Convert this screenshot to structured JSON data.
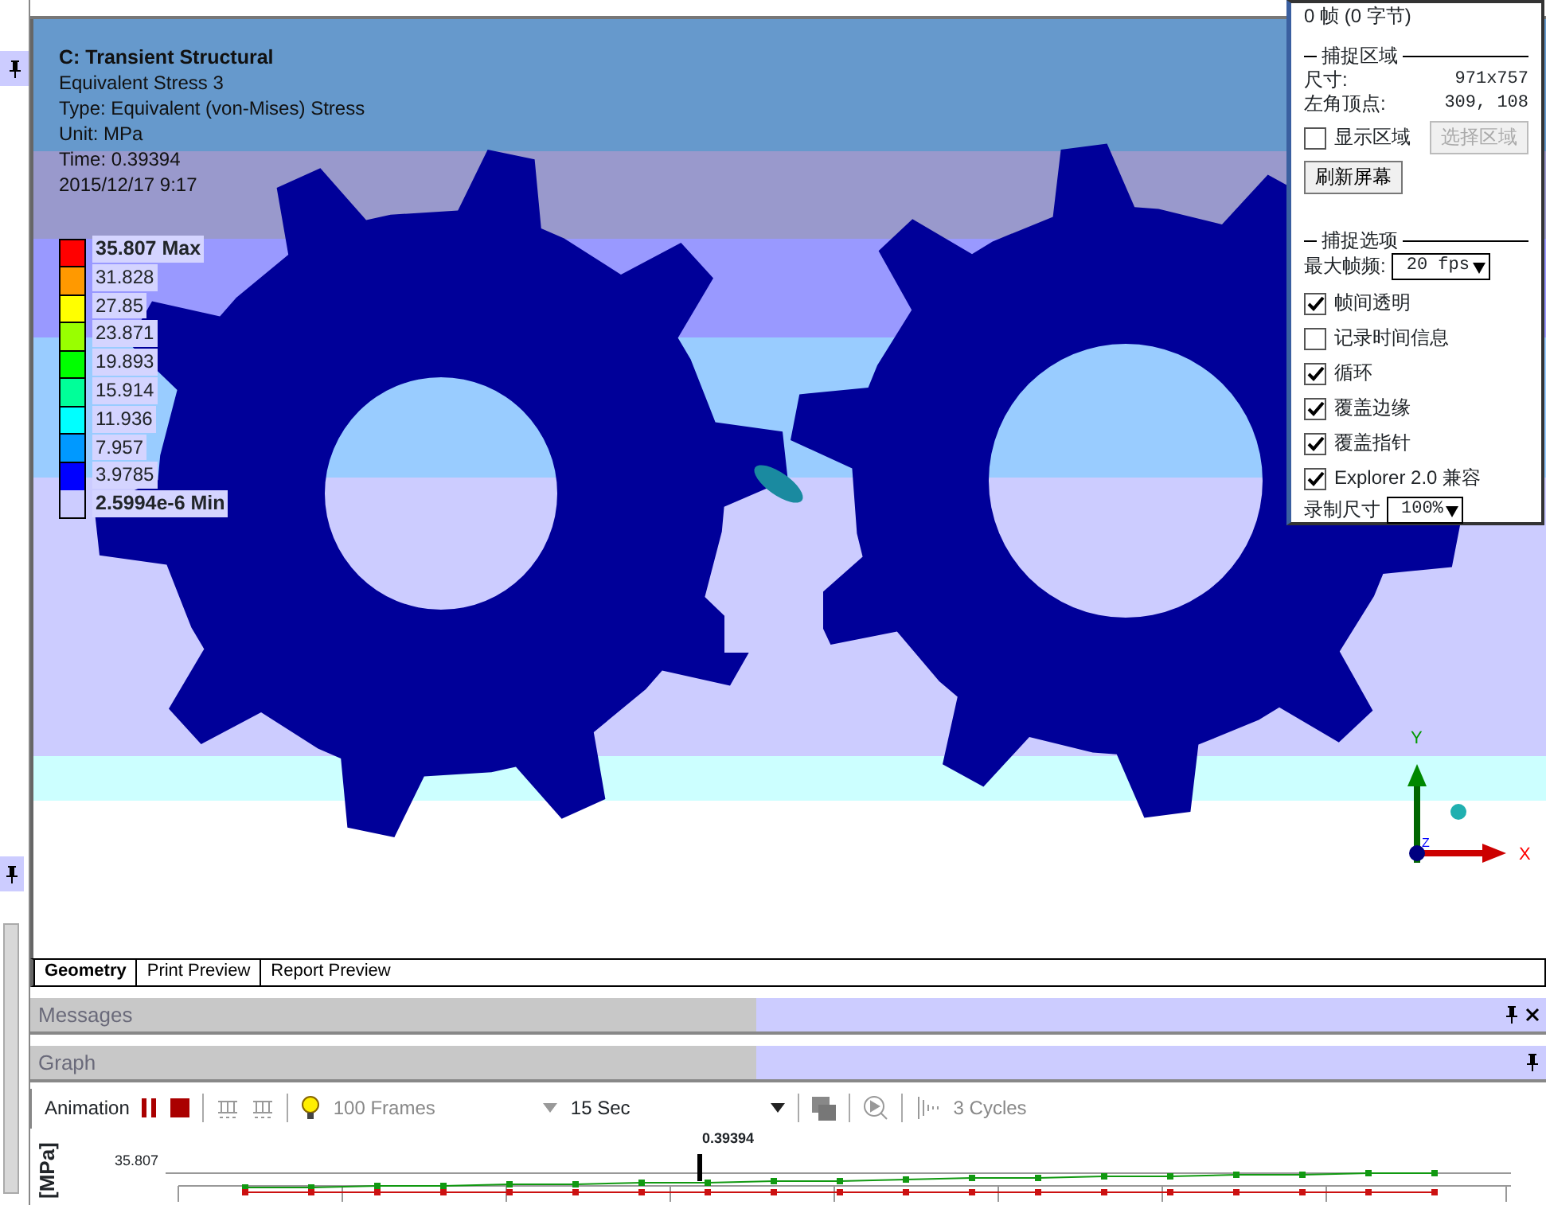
{
  "viewport": {
    "title": "C: Transient Structural",
    "lines": [
      "Equivalent Stress 3",
      "Type: Equivalent (von-Mises) Stress",
      "Unit: MPa",
      "Time: 0.39394",
      "2015/12/17 9:17"
    ],
    "legend": {
      "labels": [
        "35.807 Max",
        "31.828",
        "27.85",
        "23.871",
        "19.893",
        "15.914",
        "11.936",
        "7.957",
        "3.9785",
        "2.5994e-6 Min"
      ],
      "bins": [
        {
          "color": "#ff0000"
        },
        {
          "color": "#ff9900"
        },
        {
          "color": "#ffff00"
        },
        {
          "color": "#99ff00"
        },
        {
          "color": "#00ff00"
        },
        {
          "color": "#00ff99"
        },
        {
          "color": "#00ffff"
        },
        {
          "color": "#0099ff"
        },
        {
          "color": "#0000ff"
        }
      ]
    },
    "triad": {
      "y": "Y",
      "x": "X",
      "z": "Z"
    }
  },
  "tabs": [
    {
      "label": "Geometry",
      "selected": true
    },
    {
      "label": "Print Preview",
      "selected": false
    },
    {
      "label": "Report Preview",
      "selected": false
    }
  ],
  "panels": [
    {
      "title": "Messages",
      "closable": true
    },
    {
      "title": "Graph",
      "closable": false
    }
  ],
  "animation_toolbar": {
    "label": "Animation",
    "frames": "100 Frames",
    "duration": "15 Sec",
    "cycles": "3 Cycles"
  },
  "graph": {
    "axis_label": "[MPa]",
    "max_tick": "35.807",
    "time_marker": "0.39394"
  },
  "capture_panel": {
    "status": "0 帧 (0 字节)",
    "area_heading": "捕捉区域",
    "fields": [
      {
        "label": "尺寸:",
        "value": "971x757"
      },
      {
        "label": "左角顶点:",
        "value": "309, 108"
      }
    ],
    "show_area": {
      "label": "显示区域",
      "checked": false
    },
    "buttons": [
      {
        "label": "选择区域",
        "disabled": true
      },
      {
        "label": "刷新屏幕",
        "disabled": false
      }
    ],
    "options_heading": "捕捉选项",
    "max_rate": {
      "label": "最大帧频:",
      "value": "20 fps"
    },
    "options": [
      {
        "label": "帧间透明",
        "checked": true
      },
      {
        "label": "记录时间信息",
        "checked": false
      },
      {
        "label": "循环",
        "checked": true
      },
      {
        "label": "覆盖边缘",
        "checked": true
      },
      {
        "label": "覆盖指针",
        "checked": true
      },
      {
        "label": "Explorer 2.0 兼容",
        "checked": true
      }
    ],
    "record_size": {
      "label": "录制尺寸",
      "value": "100%"
    }
  }
}
